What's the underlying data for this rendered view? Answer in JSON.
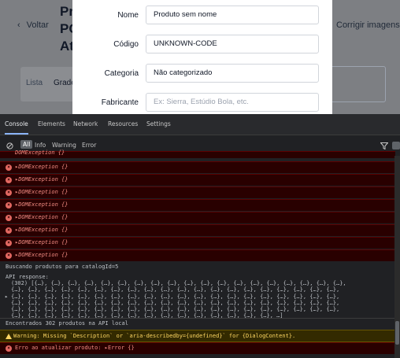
{
  "app": {
    "back_label": "Voltar",
    "title_lines": [
      "Pr",
      "PC",
      "At"
    ],
    "fix_images_label": "Corrigir imagens d",
    "tab_list": "Lista",
    "tab_grid": "Grade"
  },
  "dialog": {
    "fields": [
      {
        "label": "Nome",
        "value": "Produto sem nome",
        "placeholder": ""
      },
      {
        "label": "Código",
        "value": "UNKNOWN-CODE",
        "placeholder": ""
      },
      {
        "label": "Categoria",
        "value": "Não categorizado",
        "placeholder": ""
      },
      {
        "label": "Fabricante",
        "value": "",
        "placeholder": "Ex: Sierra, Estúdio Bola, etc."
      }
    ]
  },
  "devtools": {
    "tabs": [
      "Console",
      "Elements",
      "Network",
      "Resources",
      "Settings"
    ],
    "active_tab": "Console",
    "filters": [
      "All",
      "Info",
      "Warning",
      "Error"
    ],
    "errors": [
      "DOMException {}",
      "DOMException {}",
      "DOMException {}",
      "DOMException {}",
      "DOMException {}",
      "DOMException {}",
      "DOMException {}",
      "DOMException {}",
      "DOMException {}"
    ],
    "log_search": "Buscando produtos para catalogId=5",
    "api_label": "API response:",
    "api_lines": [
      "(302) [{…}, {…}, {…}, {…}, {…}, {…}, {…}, {…}, {…}, {…}, {…}, {…}, {…}, {…}, {…}, {…}, {…}, {…}, {…},",
      "{…}, {…}, {…}, {…}, {…}, {…}, {…}, {…}, {…}, {…}, {…}, {…}, {…}, {…}, {…}, {…}, {…}, {…}, {…}, {…},",
      "{…}, {…}, {…}, {…}, {…}, {…}, {…}, {…}, {…}, {…}, {…}, {…}, {…}, {…}, {…}, {…}, {…}, {…}, {…}, {…},",
      "{…}, {…}, {…}, {…}, {…}, {…}, {…}, {…}, {…}, {…}, {…}, {…}, {…}, {…}, {…}, {…}, {…}, {…}, {…}, {…},",
      "{…}, {…}, {…}, {…}, {…}, {…}, {…}, {…}, {…}, {…}, {…}, {…}, {…}, {…}, {…}, {…}, {…}, {…}, {…}, {…},",
      "{…}, {…}, {…}, {…}, {…}, {…}, {…}, {…}, {…}, {…}, {…}, {…}, {…}, {…}, {…}, {…}, …]"
    ],
    "log_found": "Encontrados 302 produtos na API local",
    "warning": "Warning: Missing `Description` or `aria-describedby={undefined}` for {DialogContent}.",
    "final_error": "Erro ao atualizar produto: ▸Error {}"
  },
  "colors": {
    "error_bg": "#290000",
    "error_text": "#f28b82",
    "warning_bg": "#332a00",
    "warning_text": "#fdd663",
    "devtools_bg": "#202124"
  }
}
